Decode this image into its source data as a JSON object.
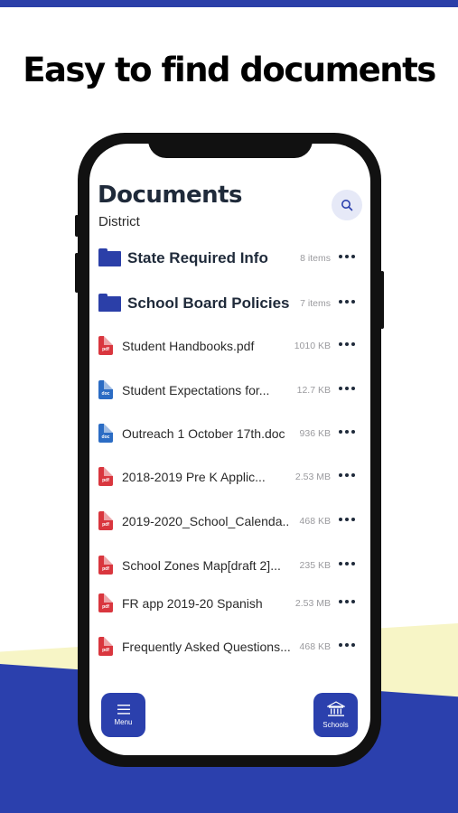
{
  "headline": "Easy to find documents",
  "screen": {
    "title": "Documents",
    "subtitle": "District",
    "search_icon": "search-icon",
    "folders": [
      {
        "name": "State Required Info",
        "count": "8 items"
      },
      {
        "name": "School Board Policies",
        "count": "7 items"
      }
    ],
    "files": [
      {
        "name": "Student Handbooks.pdf",
        "size": "1010 KB",
        "type": "pdf"
      },
      {
        "name": "Student Expectations for...",
        "size": "12.7 KB",
        "type": "doc"
      },
      {
        "name": "Outreach 1 October 17th.doc",
        "size": "936 KB",
        "type": "doc"
      },
      {
        "name": "2018-2019 Pre K Applic...",
        "size": "2.53 MB",
        "type": "pdf"
      },
      {
        "name": "2019-2020_School_Calenda..",
        "size": "468 KB",
        "type": "pdf"
      },
      {
        "name": "School Zones Map[draft 2]...",
        "size": "235 KB",
        "type": "pdf"
      },
      {
        "name": "FR app 2019-20 Spanish",
        "size": "2.53 MB",
        "type": "pdf"
      },
      {
        "name": "Frequently Asked Questions...",
        "size": "468 KB",
        "type": "pdf"
      }
    ],
    "file_type_labels": {
      "pdf": "pdf",
      "doc": "doc"
    },
    "menu_button": {
      "label": "Menu",
      "icon": "hamburger-icon"
    },
    "schools_button": {
      "label": "Schools",
      "icon": "school-building-icon"
    }
  },
  "colors": {
    "brand_blue": "#2b40ad",
    "pdf_red": "#d9363e",
    "doc_blue": "#2b6cc4",
    "cream": "#f7f5c6"
  }
}
